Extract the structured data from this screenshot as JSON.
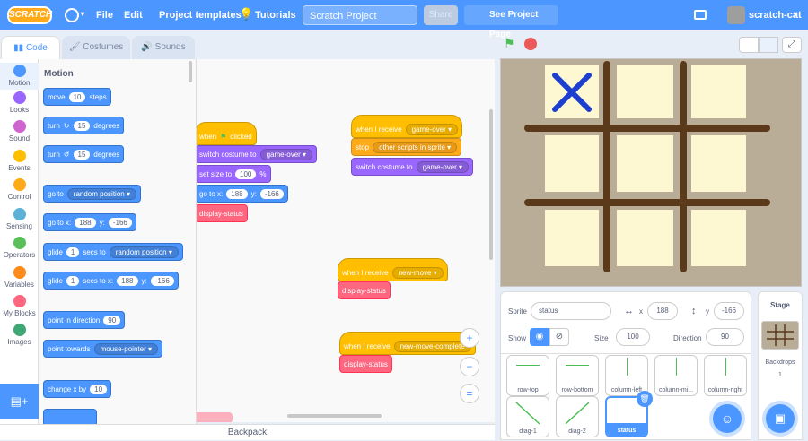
{
  "menubar": {
    "logo": "SCRATCH",
    "file": "File",
    "edit": "Edit",
    "project_templates": "Project templates",
    "tutorials": "Tutorials",
    "project_title": "Scratch Project",
    "share": "Share",
    "see_project_page": "See Project Page",
    "username": "scratch-cat"
  },
  "tabs": {
    "code": "Code",
    "costumes": "Costumes",
    "sounds": "Sounds"
  },
  "categories": [
    {
      "label": "Motion",
      "color": "#4c97ff"
    },
    {
      "label": "Looks",
      "color": "#9966ff"
    },
    {
      "label": "Sound",
      "color": "#cf63cf"
    },
    {
      "label": "Events",
      "color": "#ffbf00"
    },
    {
      "label": "Control",
      "color": "#ffab19"
    },
    {
      "label": "Sensing",
      "color": "#5cb1d6"
    },
    {
      "label": "Operators",
      "color": "#59c059"
    },
    {
      "label": "Variables",
      "color": "#ff8c1a"
    },
    {
      "label": "My Blocks",
      "color": "#ff6680"
    },
    {
      "label": "Images",
      "color": "#3fa773"
    }
  ],
  "palette": {
    "heading": "Motion",
    "move": {
      "a": "move",
      "v": "10",
      "b": "steps"
    },
    "turn_right": {
      "a": "turn",
      "v": "15",
      "b": "degrees"
    },
    "turn_left": {
      "a": "turn",
      "v": "15",
      "b": "degrees"
    },
    "go_to": {
      "a": "go to",
      "opt": "random position"
    },
    "go_to_xy": {
      "a": "go to x:",
      "x": "188",
      "b": "y:",
      "y": "-166"
    },
    "glide_to": {
      "a": "glide",
      "v": "1",
      "b": "secs to",
      "opt": "random position"
    },
    "glide_xy": {
      "a": "glide",
      "v": "1",
      "b": "secs to x:",
      "x": "188",
      "c": "y:",
      "y": "-166"
    },
    "point_dir": {
      "a": "point in direction",
      "v": "90"
    },
    "point_towards": {
      "a": "point towards",
      "opt": "mouse-pointer"
    },
    "change_x": {
      "a": "change x by",
      "v": "10"
    }
  },
  "script": {
    "s1": {
      "when": "when",
      "clicked": "clicked",
      "switch": "switch costume to",
      "costume": "game-over",
      "size": "set size to",
      "size_v": "100",
      "pct": "%",
      "goto": "go to x:",
      "x": "188",
      "y_lbl": "y:",
      "y": "-166",
      "call": "display-status"
    },
    "s2": {
      "when": "when I receive",
      "msg": "game-over",
      "stop": "stop",
      "stop_opt": "other scripts in sprite",
      "switch": "switch costume to",
      "costume": "game-over"
    },
    "s3": {
      "when": "when I receive",
      "msg": "new-move",
      "call": "display-status"
    },
    "s4": {
      "when": "when I receive",
      "msg": "new-move-complete",
      "call": "display-status"
    }
  },
  "zoom": {
    "in": "+",
    "out": "−",
    "reset": "="
  },
  "backpack": "Backpack",
  "sprite_info": {
    "sprite_label": "Sprite",
    "sprite_name": "status",
    "x_label": "x",
    "x": "188",
    "y_label": "y",
    "y": "-166",
    "show_label": "Show",
    "size_label": "Size",
    "size": "100",
    "direction_label": "Direction",
    "direction": "90"
  },
  "sprites": [
    "row-top",
    "row-bottom",
    "column-left",
    "column-mi...",
    "column-right",
    "diag-1",
    "diag-2",
    "status"
  ],
  "stage_panel": {
    "title": "Stage",
    "backdrops_label": "Backdrops",
    "backdrops_count": "1"
  }
}
